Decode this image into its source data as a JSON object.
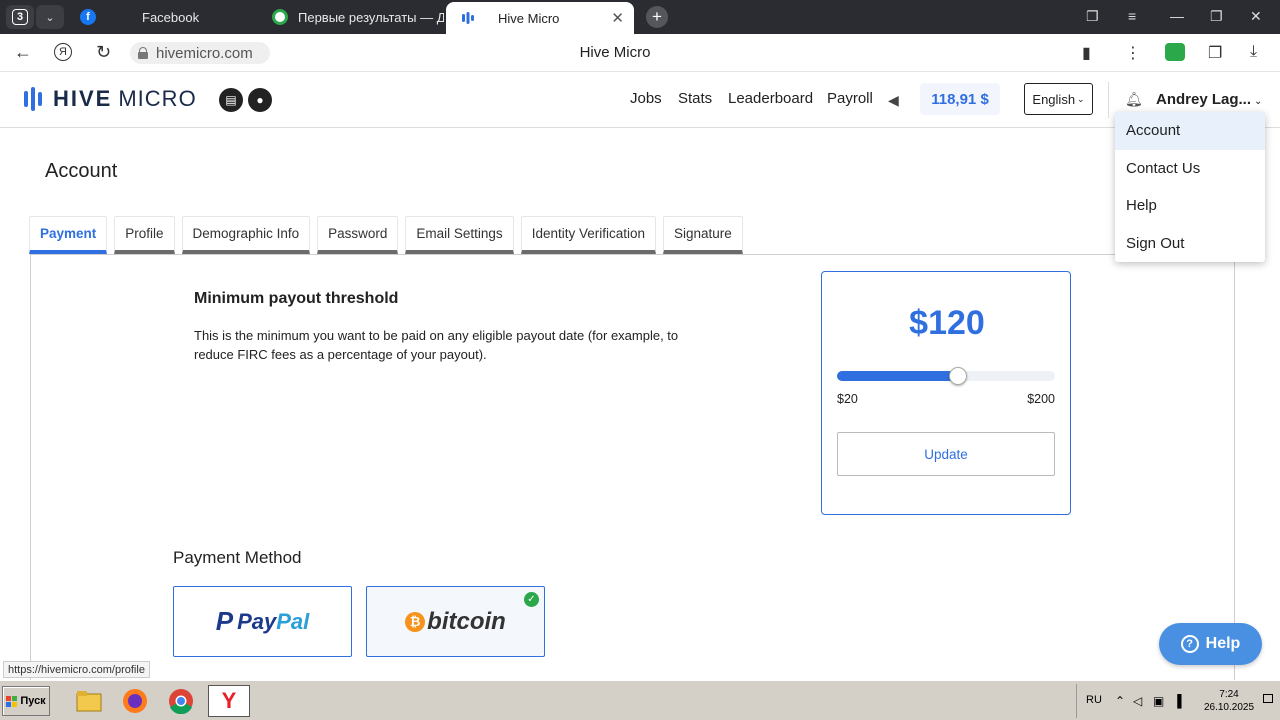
{
  "browser": {
    "tab_count": "3",
    "tabs": [
      {
        "label": "Facebook",
        "icon": "facebook-icon",
        "color": "#1877f2"
      },
      {
        "label": "Первые результаты — Да",
        "icon": "toloka-icon",
        "color": "#2aa84a"
      },
      {
        "label": "Hive Micro",
        "icon": "hive-micro-icon",
        "color": "#2f6fe0"
      }
    ],
    "url": "hivemicro.com",
    "page_title": "Hive Micro",
    "status_url": "https://hivemicro.com/profile"
  },
  "header": {
    "brand_bold": "HIVE",
    "brand_light": "MICRO",
    "nav": [
      "Jobs",
      "Stats",
      "Leaderboard",
      "Payroll"
    ],
    "balance": "118,91 $",
    "language": "English",
    "username": "Andrey Lag..."
  },
  "user_menu": [
    "Account",
    "Contact Us",
    "Help",
    "Sign Out"
  ],
  "page": {
    "heading": "Account",
    "tabs": [
      "Payment",
      "Profile",
      "Demographic Info",
      "Password",
      "Email Settings",
      "Identity Verification",
      "Signature"
    ]
  },
  "threshold": {
    "title": "Minimum payout threshold",
    "description": "This is the minimum you want to be paid on any eligible payout date (for example, to reduce FIRC fees as a percentage of your payout).",
    "amount": "$120",
    "min_label": "$20",
    "max_label": "$200",
    "value": 120,
    "min": 20,
    "max": 200,
    "update_label": "Update"
  },
  "payment_method": {
    "title": "Payment Method",
    "paypal_pay": "Pay",
    "paypal_pal": "Pal",
    "bitcoin": "bitcoin",
    "selected": "bitcoin"
  },
  "help_button": "Help",
  "taskbar": {
    "start_label": "Пуск",
    "lang": "RU",
    "time": "7:24",
    "date": "26.10.2025"
  },
  "colors": {
    "accent": "#2f6fe0",
    "paypal_dark": "#1c3a8c",
    "paypal_light": "#2a9fd8",
    "bitcoin_orange": "#f7931a",
    "check_green": "#2aa84a"
  }
}
